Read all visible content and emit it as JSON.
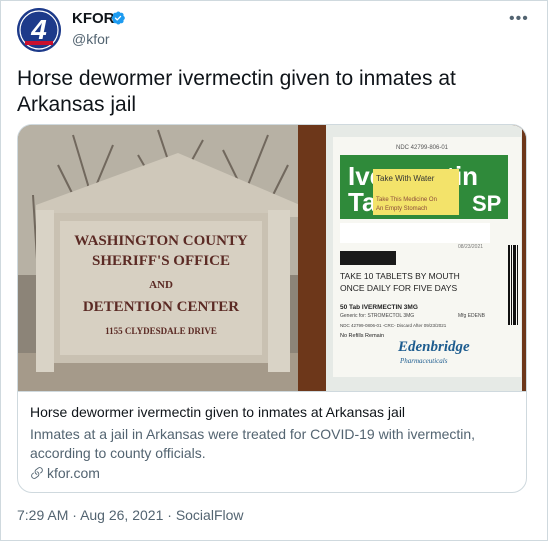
{
  "user": {
    "display_name": "KFOR",
    "handle": "@kfor",
    "verified": true,
    "avatar_label": "4"
  },
  "tweet": {
    "text": "Horse dewormer ivermectin given to inmates at Arkansas jail"
  },
  "card": {
    "title": "Horse dewormer ivermectin given to inmates at Arkansas jail",
    "description": "Inmates at a jail in Arkansas were treated for COVID-19 with ivermectin, according to county officials.",
    "domain": "kfor.com",
    "sign_text": [
      "WASHINGTON COUNTY",
      "SHERIFF'S OFFICE",
      "AND",
      "DETENTION CENTER",
      "1155 CLYDESDALE DRIVE"
    ],
    "bottle_label": {
      "ndc": "NDC 42799-806-01",
      "big_text": "Ivermectin",
      "big_text_2": "Ta",
      "big_text_3": "SP",
      "sticker_line1": "Take With Water",
      "sticker_line2": "Take This Medicine On",
      "sticker_line3": "An Empty Stomach",
      "instructions_1": "TAKE 10 TABLETS BY MOUTH",
      "instructions_2": "ONCE DAILY FOR FIVE DAYS",
      "tab_line": "50 Tab IVERMECTIN 3MG",
      "generic_line": "Generic for: STROMECTOL 3MG",
      "mfg": "Mfg EDENB",
      "ndc_line": "NDC 42799-0806-01 -CRC- Discard After 09/23/2021",
      "refills": "No Refills Remain",
      "brand": "Edenbridge",
      "brand_sub": "Pharmaceuticals",
      "date": "08/23/2021"
    }
  },
  "meta": {
    "time": "7:29 AM",
    "date": "Aug 26, 2021",
    "source": "SocialFlow",
    "separator": "·"
  },
  "colors": {
    "avatar_bg": "#1d3a8a",
    "verified": "#1d9bf0",
    "text_secondary": "#536471",
    "border": "#cfd9de"
  }
}
